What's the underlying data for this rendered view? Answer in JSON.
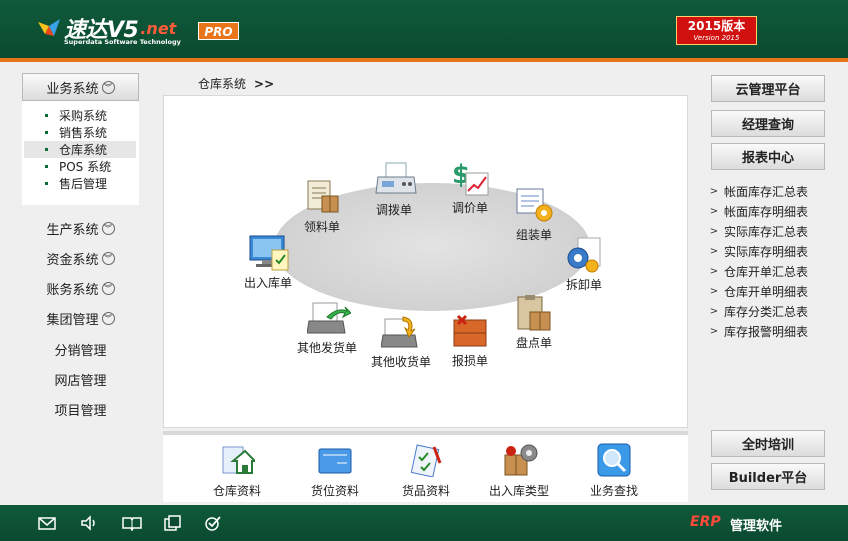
{
  "header": {
    "brand": "速达V5",
    "brand_suffix": ".net",
    "brand_sub": "Superdata Software Technology",
    "pro": "PRO",
    "version_cn": "2015版本",
    "version_en": "Version 2015"
  },
  "left_nav": {
    "business": "业务系统",
    "sub_items": [
      "采购系统",
      "销售系统",
      "仓库系统",
      "POS 系统",
      "售后管理"
    ],
    "active_sub": "仓库系统",
    "production": "生产系统",
    "funds": "资金系统",
    "accounts": "账务系统",
    "group": "集团管理",
    "distribution": "分销管理",
    "webstore": "网店管理",
    "project": "项目管理"
  },
  "breadcrumb": {
    "title": "仓库系统",
    "arrow": ">>"
  },
  "workflow": {
    "n1": "领料单",
    "n2": "调拨单",
    "n3": "调价单",
    "n4": "组装单",
    "n5": "拆卸单",
    "n6": "盘点单",
    "n7": "报损单",
    "n8": "其他收货单",
    "n9": "其他发货单",
    "n10": "出入库单"
  },
  "bottom_tools": {
    "b1": "仓库资料",
    "b2": "货位资料",
    "b3": "货品资料",
    "b4": "出入库类型",
    "b5": "业务查找"
  },
  "right_panel": {
    "cloud": "云管理平台",
    "manager": "经理查询",
    "report": "报表中心",
    "reports": [
      "帐面库存汇总表",
      "帐面库存明细表",
      "实际库存汇总表",
      "实际库存明细表",
      "仓库开单汇总表",
      "仓库开单明细表",
      "库存分类汇总表",
      "库存报警明细表"
    ],
    "training": "全时培训",
    "builder": "Builder平台"
  },
  "footer": {
    "erp": "ERP",
    "title": "管理软件"
  },
  "colors": {
    "header_green": "#0b4a30",
    "accent_orange": "#e8751a",
    "version_red": "#d11010"
  }
}
